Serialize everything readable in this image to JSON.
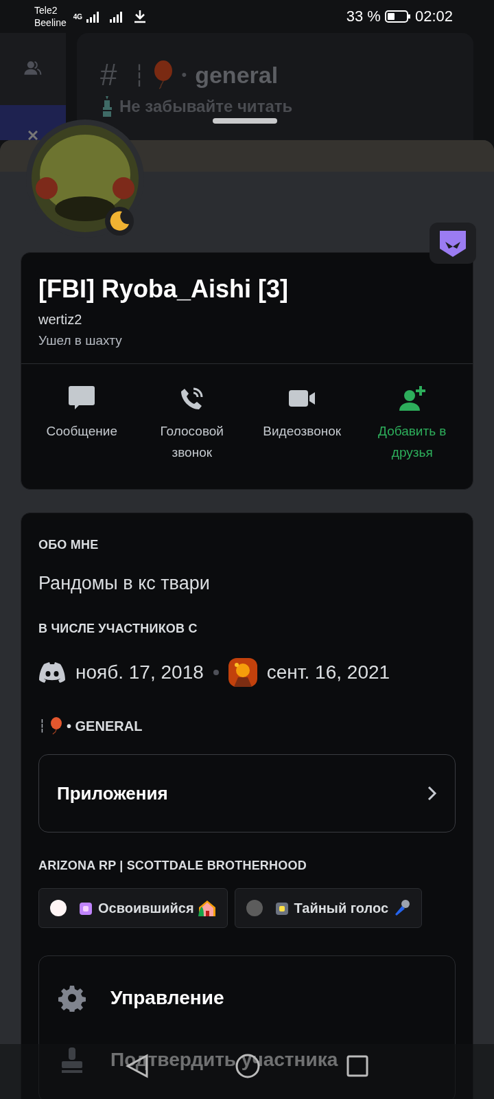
{
  "status_bar": {
    "carrier_1": "Tele2",
    "carrier_2": "Beeline",
    "network": "4G",
    "battery": "33 %",
    "time": "02:02"
  },
  "background_channel": {
    "hash": "#",
    "prefix": "┆",
    "separator": "•",
    "name": "general",
    "topic": "Не забывайте читать"
  },
  "profile": {
    "display_name": "[FBI] Ryoba_Aishi [3]",
    "username": "wertiz2",
    "status": "Ушел в шахту",
    "idle": true
  },
  "actions": [
    {
      "kind": "message",
      "label": "Сообщение",
      "accent": false
    },
    {
      "kind": "voice_call",
      "label": "Голосовой звонок",
      "accent": false
    },
    {
      "kind": "video_call",
      "label": "Видеозвонок",
      "accent": false
    },
    {
      "kind": "add_friend",
      "label": "Добавить в друзья",
      "accent": true
    }
  ],
  "about": {
    "heading": "ОБО МНЕ",
    "text": "Рандомы в кс твари"
  },
  "member_since": {
    "heading": "В ЧИСЛЕ УЧАСТНИКОВ С",
    "discord_date": "нояб. 17, 2018",
    "server_date": "сент. 16, 2021"
  },
  "channel": {
    "prefix": "┆",
    "name": "• GENERAL"
  },
  "apps_button": {
    "label": "Приложения"
  },
  "server": {
    "heading": "ARIZONA RP |  SCOTTDALE BROTHERHOOD",
    "roles": [
      {
        "name": "Освоившийся",
        "color": "#fff5f5"
      },
      {
        "name": "Тайный голос",
        "color": "#5c5c5c"
      }
    ]
  },
  "manage": [
    {
      "kind": "settings",
      "label": "Управление"
    },
    {
      "kind": "verify",
      "label": "Подтвердить участника"
    }
  ]
}
